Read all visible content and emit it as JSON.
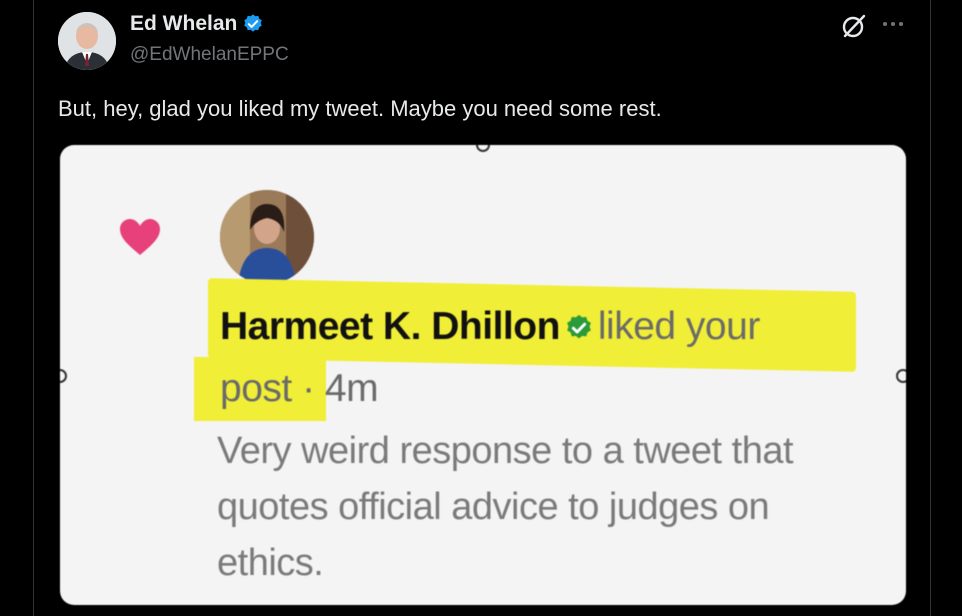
{
  "tweet": {
    "author_name": "Ed Whelan",
    "author_handle": "@EdWhelanEPPC",
    "text": "But, hey, glad you liked my tweet. Maybe you need some rest."
  },
  "embedded": {
    "liker_name": "Harmeet K. Dhillon",
    "action_part1": "liked your",
    "action_part2": "post",
    "separator": "·",
    "time": "4m",
    "quoted_text": "Very weird response to a tweet that quotes official advice to judges on ethics."
  },
  "colors": {
    "background": "#000000",
    "text_primary": "#e7e9ea",
    "text_secondary": "#71767b",
    "verified_blue": "#1d9bf0",
    "verified_green": "#2a9a3a",
    "highlight": "#f1ee37",
    "heart": "#e8407a"
  },
  "icons": [
    "verified-badge-icon",
    "grok-icon",
    "more-options-icon",
    "heart-icon"
  ]
}
